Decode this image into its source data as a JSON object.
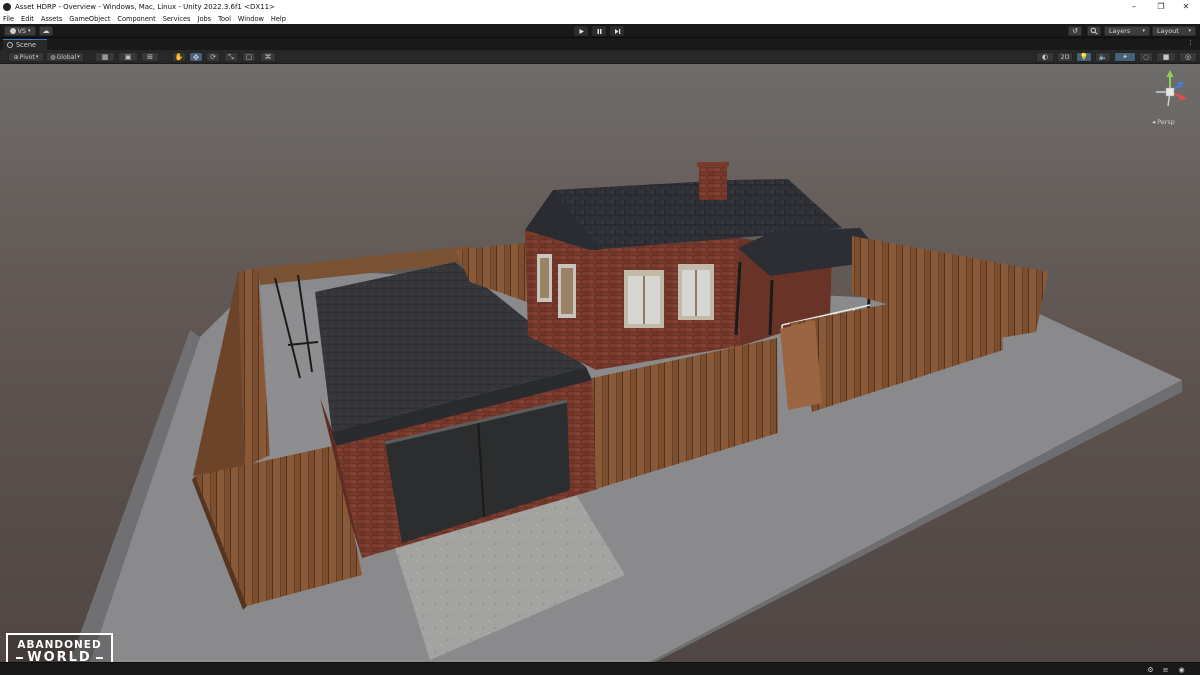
{
  "window": {
    "title": "Asset HDRP - Overview - Windows, Mac, Linux - Unity 2022.3.6f1 <DX11>",
    "minimize_glyph": "–",
    "maximize_glyph": "❐",
    "close_glyph": "✕"
  },
  "menu": {
    "items": [
      "File",
      "Edit",
      "Assets",
      "GameObject",
      "Component",
      "Services",
      "Jobs",
      "Tool",
      "Window",
      "Help"
    ]
  },
  "toolbar": {
    "account_label": "VS",
    "play_icon": "play-icon",
    "pause_icon": "pause-icon",
    "step_icon": "step-icon",
    "layers_label": "Layers",
    "layout_label": "Layout"
  },
  "tabs": {
    "scene_label": "Scene"
  },
  "scene_toolbar": {
    "pivot_label": "Pivot",
    "global_label": "Global",
    "view_2d_label": "2D"
  },
  "gizmo": {
    "projection_label": "◂ Persp"
  },
  "logo": {
    "line1": "ABANDONED",
    "line2": "WORLD"
  },
  "colors": {
    "accent": "#3a79bb",
    "editor_bg": "#191919",
    "toolbar_bg": "#282828",
    "active_tool": "#46607c"
  }
}
